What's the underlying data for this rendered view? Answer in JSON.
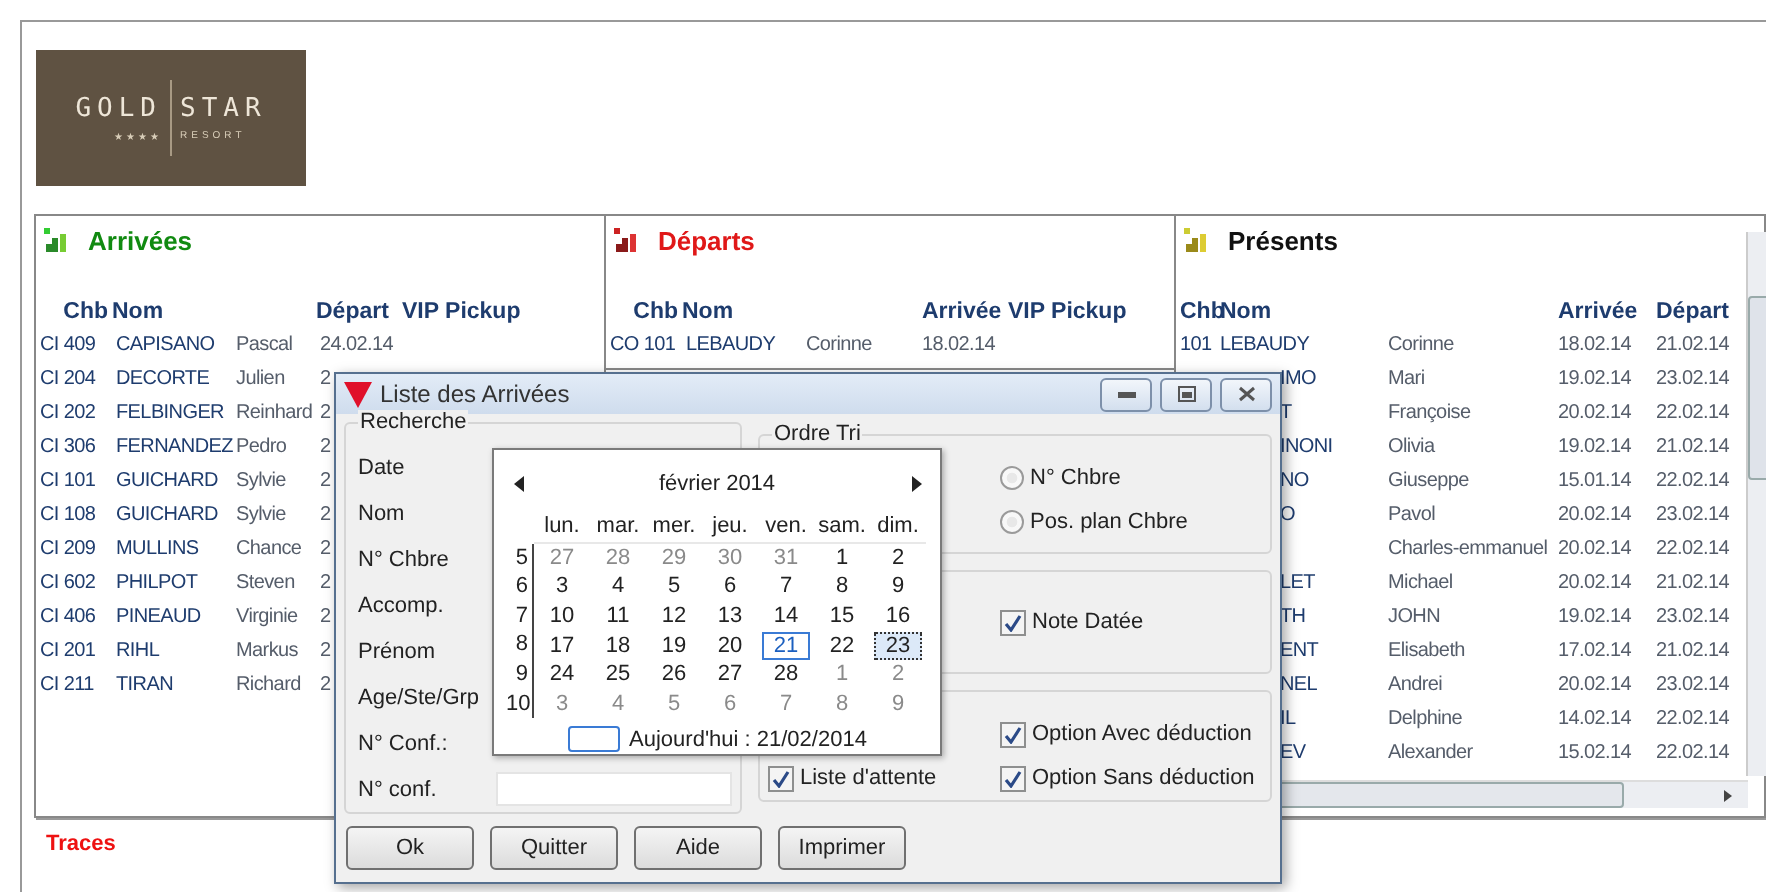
{
  "logo": {
    "word_left": "GOLD",
    "word_right": "STAR",
    "stars": "★★★★",
    "tagline": "RESORT"
  },
  "arrivees": {
    "title": "Arrivées",
    "columns": [
      "Chb",
      "Nom",
      "Départ",
      "VIP Pickup"
    ],
    "rows": [
      {
        "chb": "CI 409",
        "nom": "CAPISANO",
        "prenom": "Pascal",
        "date": "24.02.14"
      },
      {
        "chb": "CI 204",
        "nom": "DECORTE",
        "prenom": "Julien",
        "date": "2"
      },
      {
        "chb": "CI 202",
        "nom": "FELBINGER",
        "prenom": "Reinhard",
        "date": "2"
      },
      {
        "chb": "CI 306",
        "nom": "FERNANDEZ",
        "prenom": "Pedro",
        "date": "2"
      },
      {
        "chb": "CI 101",
        "nom": "GUICHARD",
        "prenom": "Sylvie",
        "date": "2"
      },
      {
        "chb": "CI 108",
        "nom": "GUICHARD",
        "prenom": "Sylvie",
        "date": "2"
      },
      {
        "chb": "CI 209",
        "nom": "MULLINS",
        "prenom": "Chance",
        "date": "2"
      },
      {
        "chb": "CI 602",
        "nom": "PHILPOT",
        "prenom": "Steven",
        "date": "2"
      },
      {
        "chb": "CI 406",
        "nom": "PINEAUD",
        "prenom": "Virginie",
        "date": "2"
      },
      {
        "chb": "CI 201",
        "nom": "RIHL",
        "prenom": "Markus",
        "date": "2"
      },
      {
        "chb": "CI 211",
        "nom": "TIRAN",
        "prenom": "Richard",
        "date": "2"
      }
    ]
  },
  "departs": {
    "title": "Départs",
    "columns": [
      "Chb",
      "Nom",
      "Arrivée",
      "VIP Pickup"
    ],
    "rows": [
      {
        "chb": "CO 101",
        "nom": "LEBAUDY",
        "prenom": "Corinne",
        "date": "18.02.14"
      }
    ]
  },
  "presents": {
    "title": "Présents",
    "columns": [
      "Chb",
      "Nom",
      "Arrivée",
      "Départ"
    ],
    "rows": [
      {
        "chb": "101",
        "nom": "LEBAUDY",
        "prenom": "Corinne",
        "arrivee": "18.02.14",
        "depart": "21.02.14"
      },
      {
        "nom": "IMO",
        "prenom": "Mari",
        "arrivee": "19.02.14",
        "depart": "23.02.14"
      },
      {
        "nom": "T",
        "prenom": "Françoise",
        "arrivee": "20.02.14",
        "depart": "22.02.14"
      },
      {
        "nom": "INONI",
        "prenom": "Olivia",
        "arrivee": "19.02.14",
        "depart": "21.02.14"
      },
      {
        "nom": "NO",
        "prenom": "Giuseppe",
        "arrivee": "15.01.14",
        "depart": "22.02.14"
      },
      {
        "nom": "O",
        "prenom": "Pavol",
        "arrivee": "20.02.14",
        "depart": "23.02.14"
      },
      {
        "prenom": "Charles-emmanuel",
        "arrivee": "20.02.14",
        "depart": "22.02.14"
      },
      {
        "nom": "LET",
        "prenom": "Michael",
        "arrivee": "20.02.14",
        "depart": "21.02.14"
      },
      {
        "nom": "TH",
        "prenom": "JOHN",
        "arrivee": "19.02.14",
        "depart": "23.02.14"
      },
      {
        "nom": "ENT",
        "prenom": "Elisabeth",
        "arrivee": "17.02.14",
        "depart": "21.02.14"
      },
      {
        "nom": "NEL",
        "prenom": "Andrei",
        "arrivee": "20.02.14",
        "depart": "23.02.14"
      },
      {
        "nom": "IL",
        "prenom": "Delphine",
        "arrivee": "14.02.14",
        "depart": "22.02.14"
      },
      {
        "nom": "EV",
        "prenom": "Alexander",
        "arrivee": "15.02.14",
        "depart": "22.02.14"
      }
    ]
  },
  "traces": "Traces",
  "dialog": {
    "title": "Liste des Arrivées",
    "recherche": {
      "title": "Recherche",
      "labels": [
        "Date",
        "Nom",
        "N° Chbre",
        "Accomp.",
        "Prénom",
        "Age/Ste/Grp",
        "N° Conf.:",
        "N° conf."
      ]
    },
    "ordre_tri": {
      "title": "Ordre Tri",
      "options": [
        {
          "label": "N° Chbre",
          "selected": false
        },
        {
          "label": "Pos. plan Chbre",
          "selected": false
        }
      ]
    },
    "note_datee": {
      "label": "Note Datée",
      "checked": true
    },
    "liste_attente": {
      "label": "Liste d'attente",
      "checked": true
    },
    "options": [
      {
        "label": "Option Avec déduction",
        "checked": true
      },
      {
        "label": "Option Sans déduction",
        "checked": true
      }
    ],
    "buttons": [
      "Ok",
      "Quitter",
      "Aide",
      "Imprimer"
    ]
  },
  "calendar": {
    "month": "février 2014",
    "weekdays": [
      "lun.",
      "mar.",
      "mer.",
      "jeu.",
      "ven.",
      "sam.",
      "dim."
    ],
    "weeks": [
      {
        "number": "5",
        "days": [
          {
            "day": "27",
            "muted": true,
            "today": false,
            "selected": false
          },
          {
            "day": "28",
            "muted": true,
            "today": false,
            "selected": false
          },
          {
            "day": "29",
            "muted": true,
            "today": false,
            "selected": false
          },
          {
            "day": "30",
            "muted": true,
            "today": false,
            "selected": false
          },
          {
            "day": "31",
            "muted": true,
            "today": false,
            "selected": false
          },
          {
            "day": "1",
            "muted": false,
            "today": false,
            "selected": false
          },
          {
            "day": "2",
            "muted": false,
            "today": false,
            "selected": false
          }
        ]
      },
      {
        "number": "6",
        "days": [
          {
            "day": "3",
            "muted": false,
            "today": false,
            "selected": false
          },
          {
            "day": "4",
            "muted": false,
            "today": false,
            "selected": false
          },
          {
            "day": "5",
            "muted": false,
            "today": false,
            "selected": false
          },
          {
            "day": "6",
            "muted": false,
            "today": false,
            "selected": false
          },
          {
            "day": "7",
            "muted": false,
            "today": false,
            "selected": false
          },
          {
            "day": "8",
            "muted": false,
            "today": false,
            "selected": false
          },
          {
            "day": "9",
            "muted": false,
            "today": false,
            "selected": false
          }
        ]
      },
      {
        "number": "7",
        "days": [
          {
            "day": "10",
            "muted": false,
            "today": false,
            "selected": false
          },
          {
            "day": "11",
            "muted": false,
            "today": false,
            "selected": false
          },
          {
            "day": "12",
            "muted": false,
            "today": false,
            "selected": false
          },
          {
            "day": "13",
            "muted": false,
            "today": false,
            "selected": false
          },
          {
            "day": "14",
            "muted": false,
            "today": false,
            "selected": false
          },
          {
            "day": "15",
            "muted": false,
            "today": false,
            "selected": false
          },
          {
            "day": "16",
            "muted": false,
            "today": false,
            "selected": false
          }
        ]
      },
      {
        "number": "8",
        "days": [
          {
            "day": "17",
            "muted": false,
            "today": false,
            "selected": false
          },
          {
            "day": "18",
            "muted": false,
            "today": false,
            "selected": false
          },
          {
            "day": "19",
            "muted": false,
            "today": false,
            "selected": false
          },
          {
            "day": "20",
            "muted": false,
            "today": false,
            "selected": false
          },
          {
            "day": "21",
            "muted": false,
            "today": true,
            "selected": false
          },
          {
            "day": "22",
            "muted": false,
            "today": false,
            "selected": false
          },
          {
            "day": "23",
            "muted": false,
            "today": false,
            "selected": true
          }
        ]
      },
      {
        "number": "9",
        "days": [
          {
            "day": "24",
            "muted": false,
            "today": false,
            "selected": false
          },
          {
            "day": "25",
            "muted": false,
            "today": false,
            "selected": false
          },
          {
            "day": "26",
            "muted": false,
            "today": false,
            "selected": false
          },
          {
            "day": "27",
            "muted": false,
            "today": false,
            "selected": false
          },
          {
            "day": "28",
            "muted": false,
            "today": false,
            "selected": false
          },
          {
            "day": "1",
            "muted": true,
            "today": false,
            "selected": false
          },
          {
            "day": "2",
            "muted": true,
            "today": false,
            "selected": false
          }
        ]
      },
      {
        "number": "10",
        "days": [
          {
            "day": "3",
            "muted": true,
            "today": false,
            "selected": false
          },
          {
            "day": "4",
            "muted": true,
            "today": false,
            "selected": false
          },
          {
            "day": "5",
            "muted": true,
            "today": false,
            "selected": false
          },
          {
            "day": "6",
            "muted": true,
            "today": false,
            "selected": false
          },
          {
            "day": "7",
            "muted": true,
            "today": false,
            "selected": false
          },
          {
            "day": "8",
            "muted": true,
            "today": false,
            "selected": false
          },
          {
            "day": "9",
            "muted": true,
            "today": false,
            "selected": false
          }
        ]
      }
    ],
    "today_label": "Aujourd'hui : 21/02/2014"
  }
}
